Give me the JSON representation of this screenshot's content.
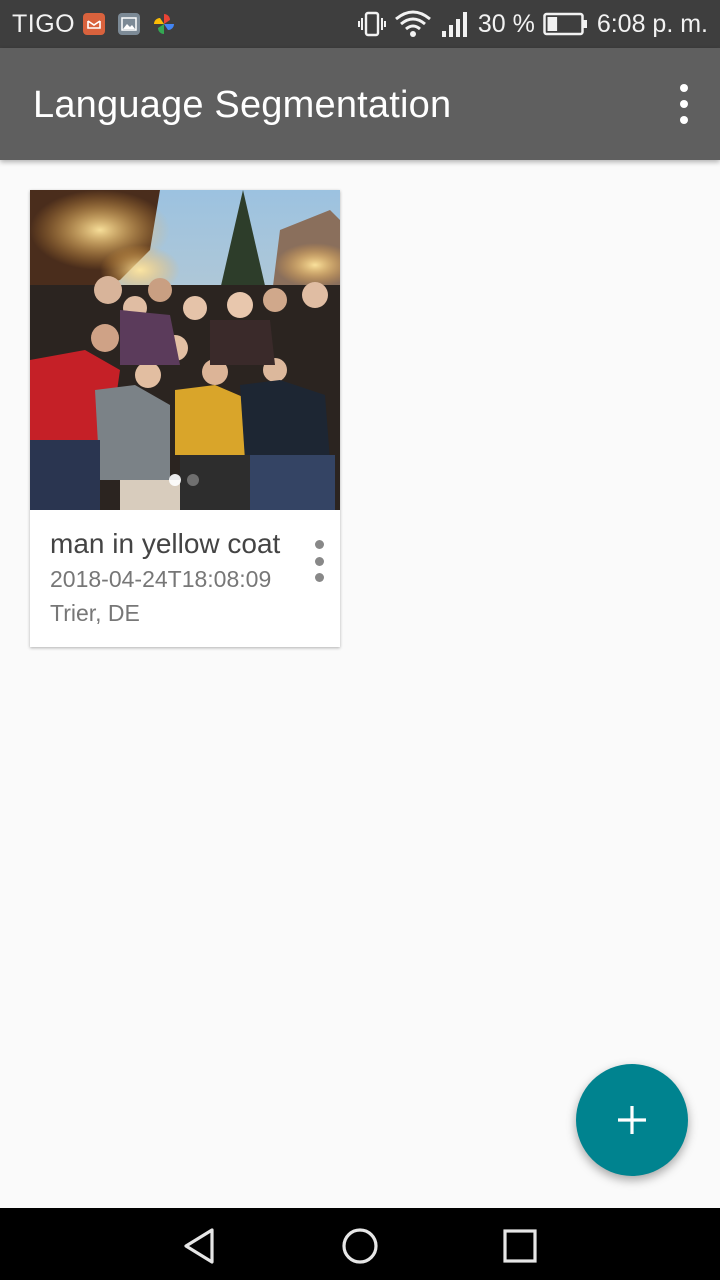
{
  "status_bar": {
    "carrier": "TIGO",
    "notification_icons": [
      "email-icon",
      "gallery-icon",
      "photos-pinwheel-icon"
    ],
    "battery_percent": "30 %",
    "battery_level": 0.3,
    "time": "6:08 p. m."
  },
  "app_bar": {
    "title": "Language Segmentation",
    "menu_icon": "more-vert-icon"
  },
  "cards": [
    {
      "title": "man in yellow coat",
      "date": "2018-04-24T18:08:09",
      "location": "Trier, DE",
      "image_subject": "group photo at christmas market",
      "carousel_pages": 2,
      "carousel_active": 0
    }
  ],
  "fab": {
    "icon": "add-icon"
  },
  "nav_bar": {
    "icons": [
      "back-icon",
      "home-icon",
      "recents-icon"
    ]
  },
  "colors": {
    "status_bar": "#3e3e3e",
    "app_bar": "#5f5f5f",
    "background": "#fafafa",
    "fab": "#00838f",
    "nav_bar": "#000000"
  }
}
